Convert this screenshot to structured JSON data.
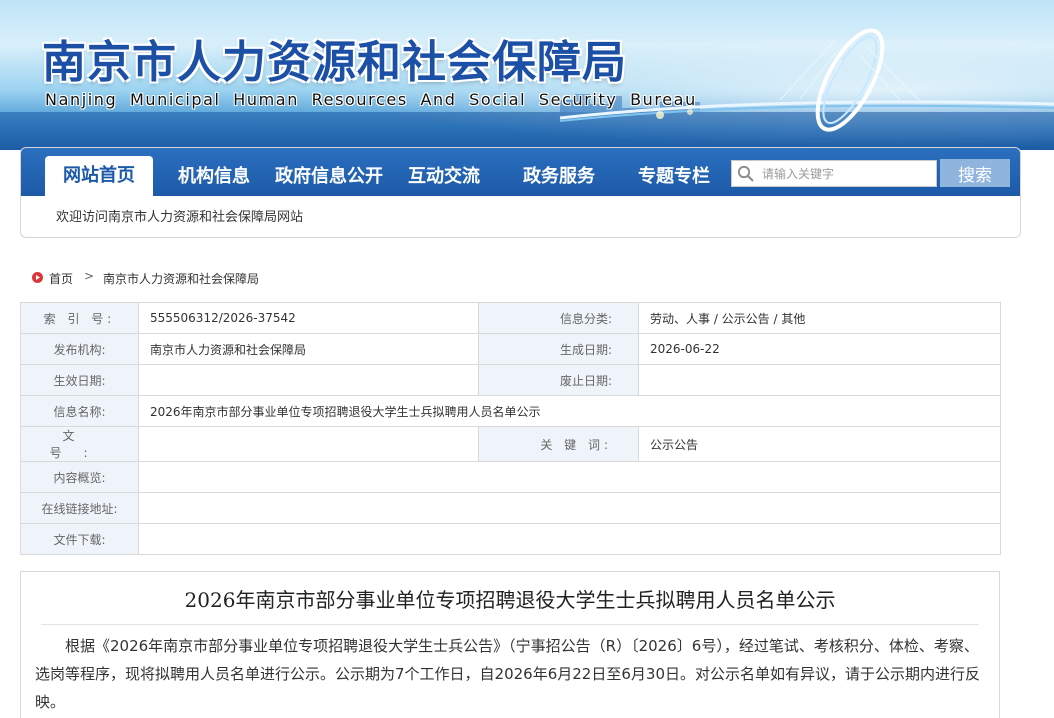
{
  "header": {
    "title_cn": "南京市人力资源和社会保障局",
    "title_en": "Nanjing Municipal Human Resources And Social Security Bureau"
  },
  "nav": {
    "items": [
      {
        "label": "网站首页",
        "active": true
      },
      {
        "label": "机构信息",
        "active": false
      },
      {
        "label": "政府信息公开",
        "active": false
      },
      {
        "label": "互动交流",
        "active": false
      },
      {
        "label": "政务服务",
        "active": false
      },
      {
        "label": "专题专栏",
        "active": false
      }
    ],
    "search_placeholder": "请输入关键字",
    "search_button": "搜索",
    "welcome_text": "欢迎访问南京市人力资源和社会保障局网站"
  },
  "breadcrumb": {
    "home": "首页",
    "separator": ">",
    "current": "南京市人力资源和社会保障局"
  },
  "info_table": {
    "index_label": "索 引 号:",
    "index_value": "555506312/2026-37542",
    "category_label": "信息分类:",
    "category_value": "劳动、人事 / 公示公告 / 其他",
    "publisher_label": "发布机构:",
    "publisher_value": "南京市人力资源和社会保障局",
    "created_label": "生成日期:",
    "created_value": "2026-06-22",
    "effective_label": "生效日期:",
    "effective_value": "",
    "abolish_label": "废止日期:",
    "abolish_value": "",
    "name_label": "信息名称:",
    "name_value": "2026年南京市部分事业单位专项招聘退役大学生士兵拟聘用人员名单公示",
    "doc_no_label": "文 号:",
    "doc_no_value": "",
    "keywords_label": "关 键 词:",
    "keywords_value": "公示公告",
    "summary_label": "内容概览:",
    "summary_value": "",
    "online_link_label": "在线链接地址:",
    "online_link_value": "",
    "download_label": "文件下载:",
    "download_value": ""
  },
  "article": {
    "title": "2026年南京市部分事业单位专项招聘退役大学生士兵拟聘用人员名单公示",
    "body": "根据《2026年南京市部分事业单位专项招聘退役大学生士兵公告》（宁事招公告（R）〔2026〕6号），经过笔试、考核积分、体检、考察、选岗等程序，现将拟聘用人员名单进行公示。公示期为7个工作日，自2026年6月22日至6月30日。对公示名单如有异议，请于公示期内进行反映。"
  },
  "colors": {
    "nav_blue": "#1c5aa8",
    "title_blue": "#1c4fa6",
    "label_bg": "#eef4fa",
    "search_button_bg": "#8fb4dd",
    "home_icon_red": "#d9373b"
  }
}
